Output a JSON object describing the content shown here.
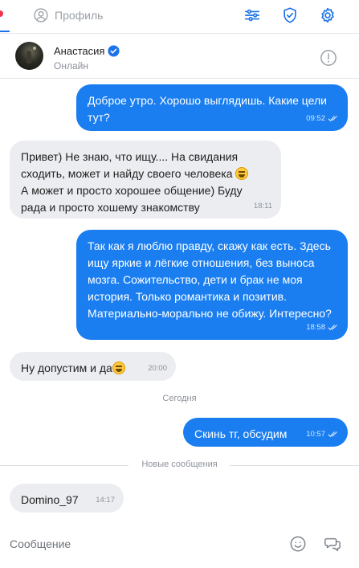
{
  "topbar": {
    "profile_label": "Профиль",
    "icons": [
      "user-circle-icon",
      "sliders-icon",
      "shield-check-icon",
      "gear-icon"
    ]
  },
  "contact": {
    "name": "Анастасия",
    "status": "Онлайн",
    "verified": true
  },
  "messages": [
    {
      "direction": "out",
      "text": "Доброе утро. Хорошо выглядишь. Какие цели тут?",
      "time": "09:52",
      "read": true
    },
    {
      "direction": "in",
      "text_a": "Привет) Не знаю, что ищу.... На свидания сходить, может и найду своего человека",
      "text_b": "А может и просто хорошее общение) Буду рада и просто хошему знакомству",
      "time": "18:11"
    },
    {
      "direction": "out",
      "text": "Так как я люблю правду, скажу как есть. Здесь ищу яркие и лёгкие отношения, без выноса мозга. Сожительство, дети и брак не моя история. Только романтика и позитив. Материально-морально не обижу. Интересно?",
      "time": "18:58",
      "read": true
    },
    {
      "direction": "in",
      "text": "Ну допустим и да",
      "time": "20:00"
    },
    {
      "direction": "out",
      "text": "Скинь тг, обсудим",
      "time": "10:57",
      "read": true
    },
    {
      "direction": "in",
      "text": "Domino_97",
      "time": "14:17"
    }
  ],
  "separators": {
    "today": "Сегодня",
    "new_messages": "Новые сообщения"
  },
  "composer": {
    "placeholder": "Сообщение"
  },
  "colors": {
    "accent": "#1a73e8",
    "outgoing_bubble": "#1a7ef0",
    "incoming_bubble": "#ebedf0",
    "notification_dot": "#f0334f"
  }
}
